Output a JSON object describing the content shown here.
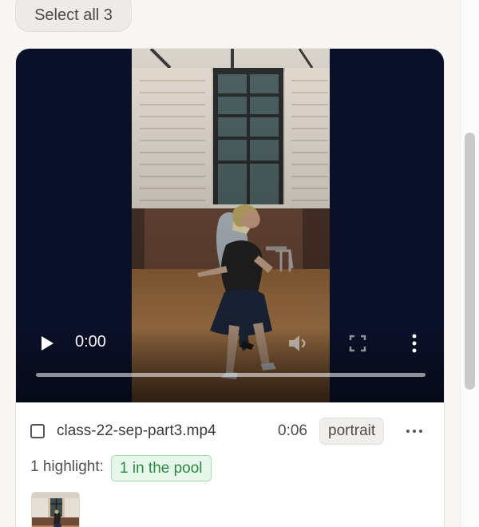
{
  "toolbar": {
    "select_all_label": "Select all 3"
  },
  "video": {
    "current_time": "0:00",
    "progress": 0,
    "controls": {
      "play_icon": "play-icon",
      "volume_icon": "volume-icon",
      "fullscreen_icon": "fullscreen-icon",
      "menu_icon": "more-vertical-icon"
    }
  },
  "file": {
    "name": "class-22-sep-part3.mp4",
    "duration": "0:06",
    "orientation": "portrait",
    "more_icon": "more-horizontal-icon"
  },
  "highlights": {
    "label": "1 highlight:",
    "tag": "1 in the pool"
  },
  "colors": {
    "background": "#f8f7f4",
    "video_background": "#0a1028",
    "badge_background": "#efeeeb",
    "highlight_tag_background": "#e7f6ea",
    "highlight_tag_text": "#2d8a45"
  }
}
